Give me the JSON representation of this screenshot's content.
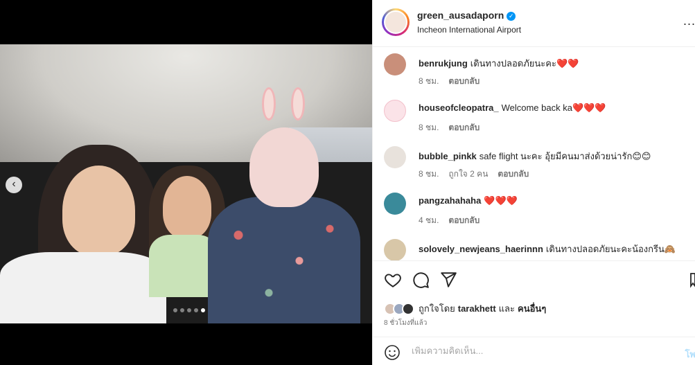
{
  "post": {
    "username": "green_ausadaporn",
    "location": "Incheon International Airport",
    "more_label": "...",
    "carousel_dots": 5,
    "carousel_active": 4
  },
  "comments": [
    {
      "user": "benrukjung",
      "text": "เดินทางปลอดภัยนะคะ",
      "hearts": "❤️❤️",
      "time": "8 ชม.",
      "likes": "",
      "reply": "ตอบกลับ",
      "avatar_color": "#c98f7a"
    },
    {
      "user": "houseofcleopatra_",
      "text": "Welcome back ka",
      "hearts": "❤️❤️❤️",
      "time": "8 ชม.",
      "likes": "",
      "reply": "ตอบกลับ",
      "avatar_color": "#f7c9d2"
    },
    {
      "user": "bubble_pinkk",
      "text": "safe flight นะคะ อุ้ยมีคนมาส่งด้วยน่ารัก😊😊",
      "hearts": "",
      "time": "8 ชม.",
      "likes": "ถูกใจ 2 คน",
      "reply": "ตอบกลับ",
      "avatar_color": "#e8e2dc"
    },
    {
      "user": "pangzahahaha",
      "text": "",
      "hearts": "❤️❤️❤️",
      "time": "4 ชม.",
      "likes": "",
      "reply": "ตอบกลับ",
      "avatar_color": "#3a8a9a"
    },
    {
      "user": "solovely_newjeans_haerinnn",
      "text": "เดินทางปลอดภัยนะคะน้องกรีน🙈",
      "hearts": "",
      "time": "",
      "likes": "",
      "reply": "",
      "avatar_color": "#d8c7a8"
    }
  ],
  "likes": {
    "prefix": "ถูกใจโดย",
    "user": "tarakhett",
    "conj": "และ",
    "others": "คนอื่นๆ"
  },
  "time_ago": "8 ชั่วโมงที่แล้ว",
  "add_comment": {
    "placeholder": "เพิ่มความคิดเห็น...",
    "post_label": "โพ"
  },
  "colors": {
    "accent": "#0095f6",
    "heart": "#ed1c24",
    "muted": "#737373"
  }
}
